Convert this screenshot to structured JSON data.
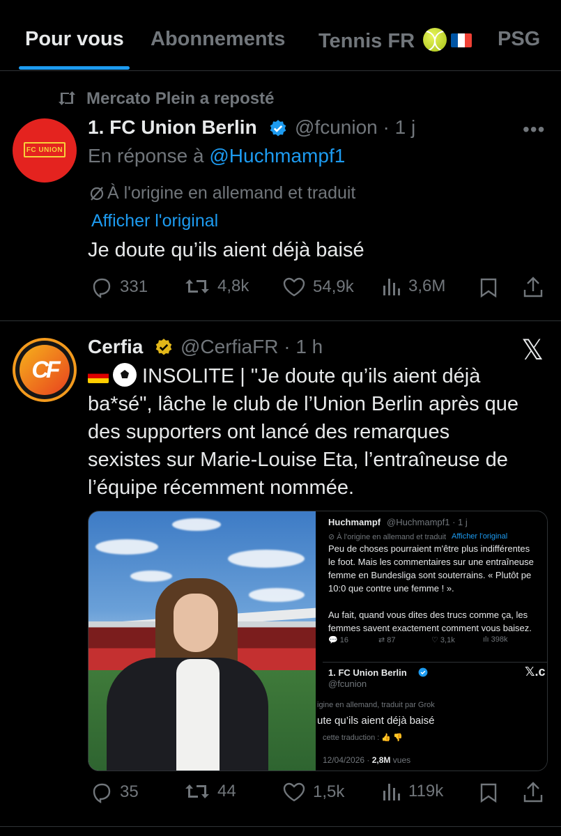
{
  "tabs": [
    {
      "label": "Pour vous",
      "active": true
    },
    {
      "label": "Abonnements",
      "active": false
    },
    {
      "label": "Tennis FR",
      "active": false
    },
    {
      "label": "PSG",
      "active": false
    }
  ],
  "post1": {
    "repost_label": "Mercato Plein a reposté",
    "author_name": "1. FC Union Berlin",
    "handle_time": "@fcunion · 1 j",
    "reply_prefix": "En réponse à",
    "reply_mention": "@Huchmampf1",
    "translated_note": "À l'origine en allemand et traduit",
    "show_original": "Afficher l'original",
    "text": "Je doute qu’ils aient déjà baisé",
    "avatar_text": "FC UNION",
    "stats": {
      "replies": "331",
      "reposts": "4,8k",
      "likes": "54,9k",
      "views": "3,6M"
    }
  },
  "post2": {
    "author_name": "Cerfia",
    "handle_time": "@CerfiaFR · 1 h",
    "avatar_text": "CF",
    "text_lines": [
      " INSOLITE | \"Je doute qu’ils aient déjà",
      "ba*sé\", lâche le club de l’Union Berlin après que",
      "des supporters ont lancé des remarques",
      "sexistes sur Marie-Louise Eta, l’entraîneuse de",
      "l’équipe récemment nommée."
    ],
    "stats": {
      "replies": "35",
      "reposts": "44",
      "likes": "1,5k",
      "views": "119k"
    },
    "embedded": {
      "quoted_name": "Huchmampf",
      "quoted_handle": "@Huchmampf1 · 1 j",
      "translated_note": "À l'origine en allemand et traduit",
      "show_original": "Afficher l'original",
      "quoted_text": "Peu de choses pourraient m'être plus indifférentes\nle foot. Mais les commentaires sur une entraîneuse\nfemme en Bundesliga sont souterrains. « Plutôt pe\n10:0 que contre une femme ! ».\n\nAu fait, quand vous dites des trucs comme ça, les\nfemmes savent exactement comment vous baisez.",
      "quoted_stats": {
        "replies": "16",
        "reposts": "87",
        "likes": "3,1k",
        "views": "398k"
      },
      "club_name": "1. FC Union Berlin",
      "club_handle": "@fcunion",
      "x_mark": "𝕏.c",
      "club_translated": "igine en allemand, traduit par Grok",
      "club_text": "ute qu’ils aient déjà baisé",
      "rate_translation": "cette traduction :",
      "date": "12/04/2026 ·",
      "views_count": "2,8M",
      "views_label": "vues"
    }
  },
  "colors": {
    "accent": "#1d9bf0",
    "muted": "#71767b",
    "text": "#e7e9ea",
    "background": "#000000",
    "verified_blue": "#1d9bf0",
    "verified_gold": "#e2b719"
  }
}
